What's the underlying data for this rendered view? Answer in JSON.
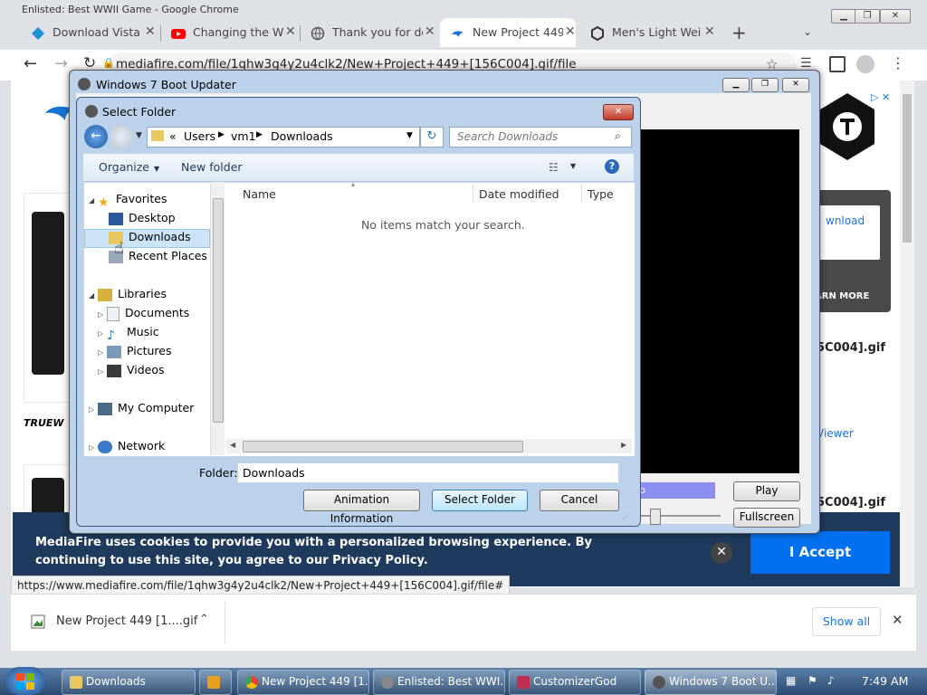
{
  "window_title": "Enlisted: Best WWII Game - Google Chrome",
  "tabs": [
    {
      "label": "Download Vista I",
      "icon": "vista-icon"
    },
    {
      "label": "Changing the W",
      "icon": "youtube-icon"
    },
    {
      "label": "Thank you for do",
      "icon": "globe-icon"
    },
    {
      "label": "New Project 449",
      "icon": "mediafire-icon"
    },
    {
      "label": "Men's Light Wei",
      "icon": "temu-icon"
    }
  ],
  "url": "mediafire.com/file/1qhw3g4y2u4clk2/New+Project+449+[156C004].gif/file",
  "status_url": "https://www.mediafire.com/file/1qhw3g4y2u4clk2/New+Project+449+[156C004].gif/file#",
  "page": {
    "side_text_1": "wnload",
    "learn_more": "ARN MORE",
    "file_name_1": "5C004].gif",
    "viewer": "Viewer",
    "file_name_2": "5C004].gif",
    "brand_text": "TRUEW"
  },
  "cookie": {
    "text": "MediaFire uses cookies to provide you with a personalized browsing experience. By continuing to use this site, you agree to our Privacy Policy.",
    "accept": "I Accept"
  },
  "downloads_bar": {
    "item": "New Project 449 [1....gif",
    "show_all": "Show all"
  },
  "boot_updater": {
    "title": "Windows 7 Boot Updater",
    "play": "Play",
    "fullscreen": "Fullscreen",
    "progress_label": "p"
  },
  "select_folder": {
    "title": "Select Folder",
    "breadcrumb": [
      "«",
      "Users",
      "vm1",
      "Downloads"
    ],
    "search_placeholder": "Search Downloads",
    "organize": "Organize",
    "new_folder": "New folder",
    "nav": {
      "favorites": "Favorites",
      "desktop": "Desktop",
      "downloads": "Downloads",
      "recent": "Recent Places",
      "libraries": "Libraries",
      "documents": "Documents",
      "music": "Music",
      "pictures": "Pictures",
      "videos": "Videos",
      "computer": "My Computer",
      "network": "Network"
    },
    "columns": [
      "Name",
      "Date modified",
      "Type"
    ],
    "empty_message": "No items match your search.",
    "folder_label": "Folder:",
    "folder_value": "Downloads",
    "animation_info": "Animation Information",
    "select_button": "Select Folder",
    "cancel_button": "Cancel"
  },
  "taskbar": {
    "items": [
      "Downloads",
      "",
      "New Project 449 [1...",
      "Enlisted: Best WWI...",
      "CustomizerGod",
      "Windows 7 Boot U..."
    ],
    "clock": "7:49 AM"
  }
}
